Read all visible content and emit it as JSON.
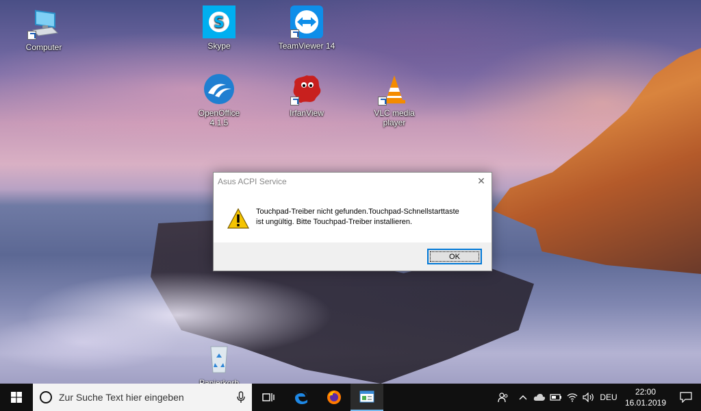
{
  "desktop": {
    "icons": [
      {
        "label": "Computer"
      },
      {
        "label": "Skype"
      },
      {
        "label": "TeamViewer 14"
      },
      {
        "label": "OpenOffice 4.1.5"
      },
      {
        "label": "IrfanView"
      },
      {
        "label": "VLC media player"
      },
      {
        "label": "Papierkorb"
      }
    ]
  },
  "dialog": {
    "title": "Asus ACPI Service",
    "message_line1": "Touchpad-Treiber nicht gefunden.Touchpad-Schnellstarttaste",
    "message_line2": "ist ungültig. Bitte Touchpad-Treiber installieren.",
    "ok_label": "OK",
    "close_glyph": "✕"
  },
  "taskbar": {
    "search_placeholder": "Zur Suche Text hier eingeben",
    "language": "DEU",
    "time": "22:00",
    "date": "16.01.2019"
  },
  "colors": {
    "accent": "#0078d7",
    "taskbar": "#101010",
    "skype": "#00aff0",
    "teamviewer": "#0e8ee9",
    "vlc": "#f48b00"
  }
}
